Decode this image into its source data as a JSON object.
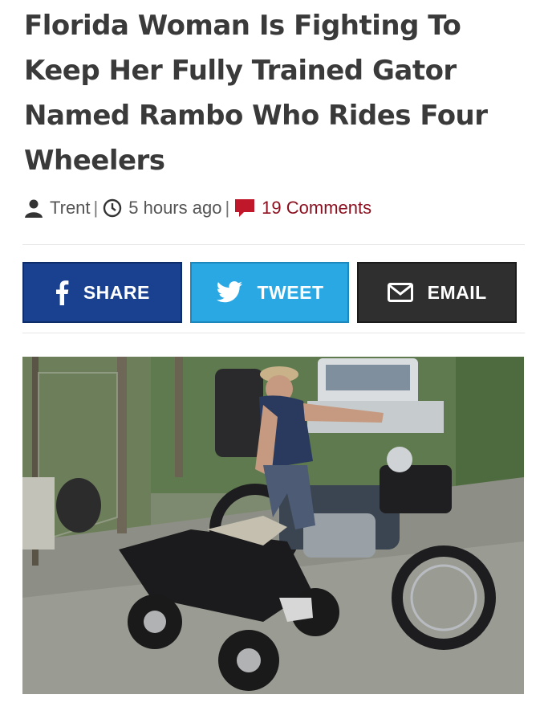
{
  "article": {
    "headline": "Florida Woman Is Fighting To Keep Her Fully Trained Gator Named Rambo Who Rides Four Wheelers",
    "author": "Trent",
    "time": "5 hours ago",
    "comments": "19 Comments"
  },
  "share": {
    "facebook_label": "SHARE",
    "twitter_label": "TWEET",
    "email_label": "EMAIL"
  },
  "colors": {
    "facebook": "#1a4190",
    "twitter": "#2aa8e4",
    "email": "#2f2f2f",
    "comments": "#8b0f1e"
  },
  "icons": [
    "user-icon",
    "clock-icon",
    "comment-icon",
    "facebook-icon",
    "twitter-icon",
    "email-icon"
  ]
}
